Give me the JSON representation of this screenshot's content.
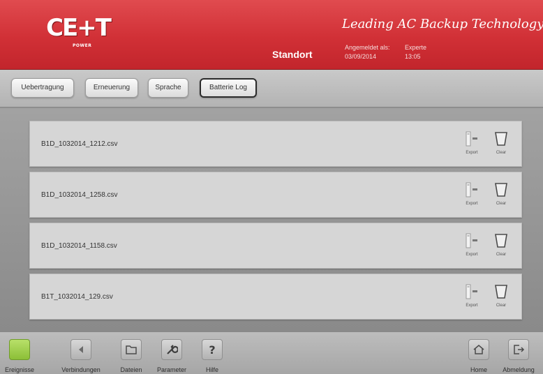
{
  "header": {
    "logo_text": "CE+T",
    "logo_sub": "POWER",
    "location": "Standort",
    "tagline": "Leading AC Backup Technology",
    "login_label": "Angemeldet als:",
    "login_user": "Experte",
    "date": "03/09/2014",
    "time": "13:05"
  },
  "tabs": [
    {
      "label": "Uebertragung",
      "active": false
    },
    {
      "label": "Erneuerung",
      "active": false
    },
    {
      "label": "Sprache",
      "active": false
    },
    {
      "label": "Batterie Log",
      "active": true
    }
  ],
  "files": [
    {
      "name": "B1D_1032014_1212.csv",
      "export_label": "Export",
      "clear_label": "Clear"
    },
    {
      "name": "B1D_1032014_1258.csv",
      "export_label": "Export",
      "clear_label": "Clear"
    },
    {
      "name": "B1D_1032014_1158.csv",
      "export_label": "Export",
      "clear_label": "Clear"
    },
    {
      "name": "B1T_1032014_129.csv",
      "export_label": "Export",
      "clear_label": "Clear"
    }
  ],
  "bottom_nav": {
    "left": [
      {
        "label": "Ereignisse",
        "icon": "event-status-icon",
        "color": "#9ccd4a"
      },
      {
        "label": "Verbindungen",
        "icon": "connections-icon"
      },
      {
        "label": "Dateien",
        "icon": "folder-icon"
      },
      {
        "label": "Parameter",
        "icon": "wrench-icon"
      },
      {
        "label": "Hilfe",
        "icon": "help-icon"
      }
    ],
    "right": [
      {
        "label": "Home",
        "icon": "home-icon"
      },
      {
        "label": "Abmeldung",
        "icon": "logout-icon"
      }
    ]
  },
  "colors": {
    "header_red": "#d13036",
    "event_green": "#9ccd4a"
  }
}
